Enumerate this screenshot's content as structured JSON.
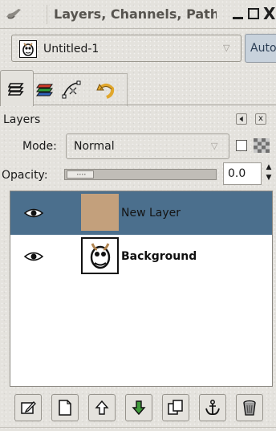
{
  "window": {
    "title": "Layers, Channels, Paths,",
    "menu_icon": "window-menu-icon",
    "controls": {
      "minimize": "minimize-icon",
      "maximize": "maximize-icon",
      "close_glyph": "X"
    }
  },
  "image_selector": {
    "current_image": "Untitled-1",
    "thumb_icon": "gimp-wilber-icon",
    "auto_label": "Auto"
  },
  "tabs": [
    {
      "name": "layers",
      "icon": "layers-tab-icon",
      "selected": true
    },
    {
      "name": "channels",
      "icon": "channels-tab-icon",
      "selected": false
    },
    {
      "name": "paths",
      "icon": "paths-tab-icon",
      "selected": false
    },
    {
      "name": "undo",
      "icon": "undo-history-tab-icon",
      "selected": false
    }
  ],
  "panel": {
    "title": "Layers",
    "close_glyph": "x",
    "mode_label": "Mode:",
    "mode_value": "Normal",
    "keep_transparency_checked": false,
    "opacity_label": "Opacity:",
    "opacity_value": "0.0",
    "spin_up": "▲",
    "spin_down": "▼"
  },
  "layers": [
    {
      "name": "New Layer",
      "visible": true,
      "selected": true,
      "thumb_color": "#c3a07c"
    },
    {
      "name": "Background",
      "visible": true,
      "selected": false,
      "thumb_color": "#ffffff"
    }
  ],
  "toolbar": [
    {
      "action": "edit-layer-attributes",
      "icon": "edit-layer-icon"
    },
    {
      "action": "new-layer",
      "icon": "new-layer-icon"
    },
    {
      "action": "raise-layer",
      "icon": "raise-layer-icon"
    },
    {
      "action": "lower-layer",
      "icon": "lower-layer-icon"
    },
    {
      "action": "duplicate-layer",
      "icon": "duplicate-layer-icon"
    },
    {
      "action": "anchor-layer",
      "icon": "anchor-layer-icon"
    },
    {
      "action": "delete-layer",
      "icon": "delete-layer-icon"
    }
  ],
  "colors": {
    "background": "#e4e2dd",
    "selection": "#4b6f8d",
    "auto_button": "#c8d2dc"
  }
}
